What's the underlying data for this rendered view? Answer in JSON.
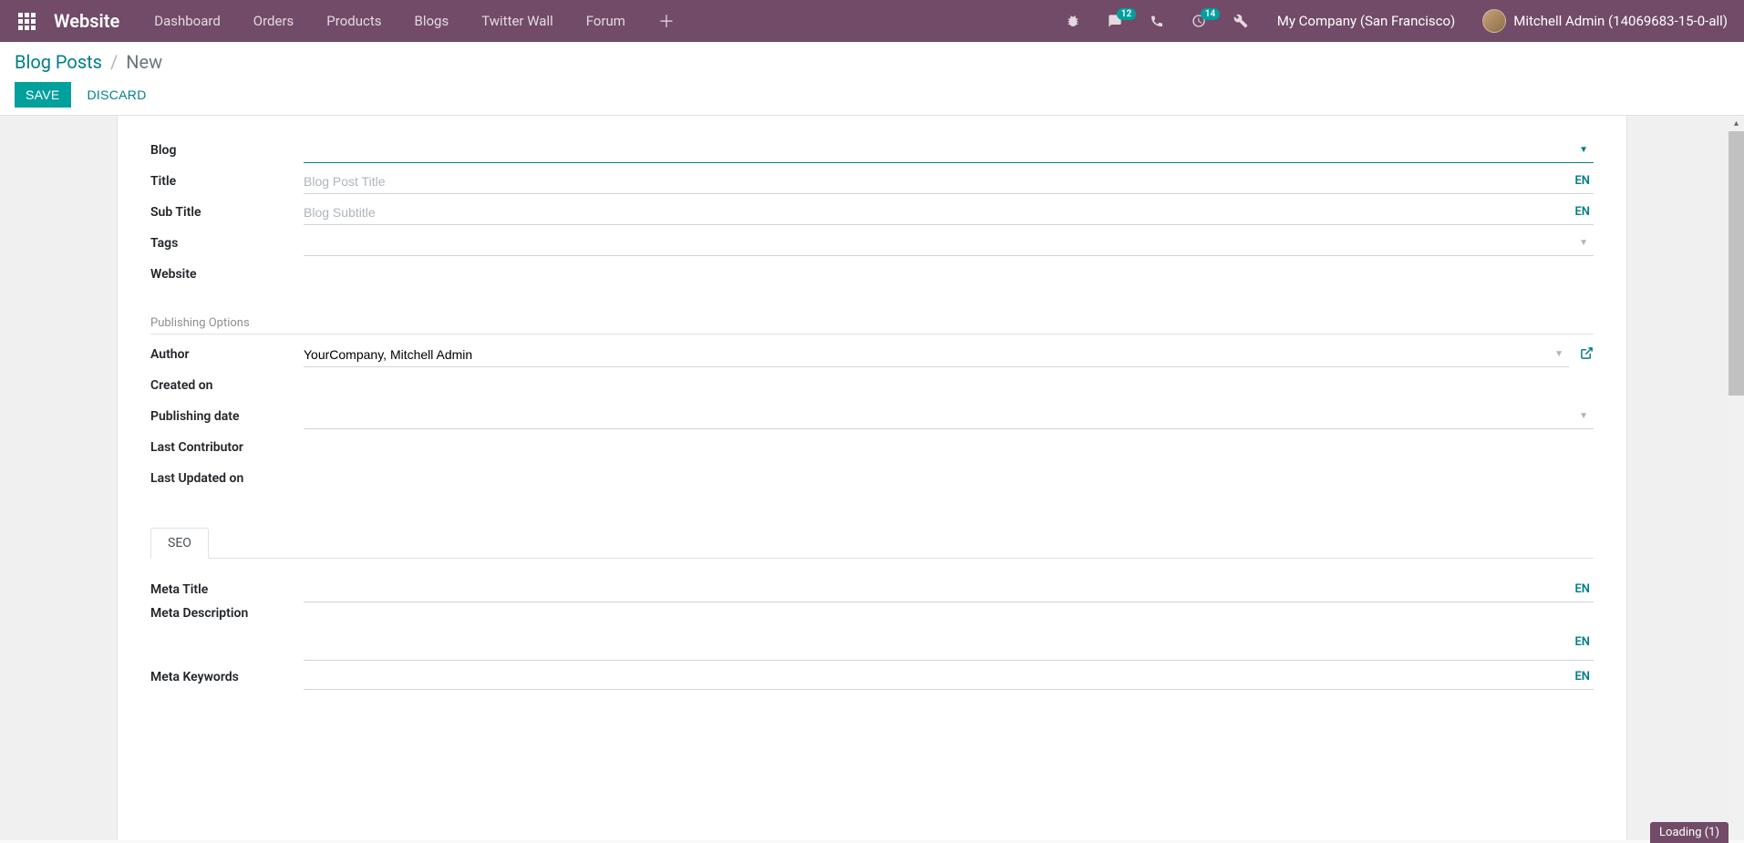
{
  "navbar": {
    "brand": "Website",
    "menu": [
      "Dashboard",
      "Orders",
      "Products",
      "Blogs",
      "Twitter Wall",
      "Forum"
    ],
    "messages_badge": "12",
    "activities_badge": "14",
    "company": "My Company (San Francisco)",
    "user": "Mitchell Admin (14069683-15-0-all)"
  },
  "breadcrumb": {
    "parent": "Blog Posts",
    "current": "New"
  },
  "buttons": {
    "save": "SAVE",
    "discard": "DISCARD"
  },
  "form": {
    "labels": {
      "blog": "Blog",
      "title": "Title",
      "subtitle": "Sub Title",
      "tags": "Tags",
      "website": "Website",
      "author": "Author",
      "created_on": "Created on",
      "publishing_date": "Publishing date",
      "last_contributor": "Last Contributor",
      "last_updated_on": "Last Updated on",
      "meta_title": "Meta Title",
      "meta_description": "Meta Description",
      "meta_keywords": "Meta Keywords"
    },
    "placeholders": {
      "title": "Blog Post Title",
      "subtitle": "Blog Subtitle"
    },
    "values": {
      "author": "YourCompany, Mitchell Admin"
    },
    "section_publishing": "Publishing Options",
    "lang": "EN",
    "tab_seo": "SEO"
  },
  "loading": "Loading (1)"
}
